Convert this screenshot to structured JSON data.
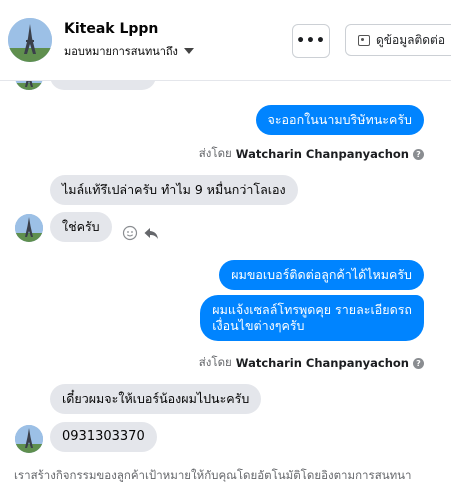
{
  "header": {
    "page_name": "Kiteak Lppn",
    "assign_label": "มอบหมายการสนทนาถึง",
    "more_label": "•••",
    "contact_label": "ดูข้อมูลติดต่อ"
  },
  "messages": [
    {
      "id": "m1",
      "side": "out",
      "text": "จะออกในนามบริษัทนะครับ"
    },
    {
      "id": "m2",
      "side": "in",
      "text": "ไมล์แท้รึเปล่าครับ ทำไม 9 หมื่นกว่าโลเอง"
    },
    {
      "id": "m3",
      "side": "in",
      "text": "ใช่ครับ"
    },
    {
      "id": "m4",
      "side": "out",
      "text": "ผมขอเบอร์ติดต่อลูกค้าได้ไหมครับ"
    },
    {
      "id": "m5",
      "side": "out",
      "lines": [
        "ผมแจ้งเซลล์โทรพูดคุย รายละเอียดรถ",
        "เงื่อนไขต่างๆครับ"
      ]
    },
    {
      "id": "m6",
      "side": "in",
      "text": "เดี๋ยวผมจะให้เบอร์น้องผมไปนะครับ"
    },
    {
      "id": "m7",
      "side": "in",
      "text": "0931303370"
    }
  ],
  "sent_by": {
    "prefix": "ส่งโดย",
    "name": "Watcharin Chanpanyachon",
    "help_icon": "?"
  },
  "footer": {
    "notice": "เราสร้างกิจกรรมของลูกค้าเป้าหมายให้กับคุณโดยอัตโนมัติโดยอิงตามการสนทนา"
  },
  "colors": {
    "outgoing": "#0084ff",
    "incoming": "#e4e6eb",
    "subtext": "#65676b"
  }
}
